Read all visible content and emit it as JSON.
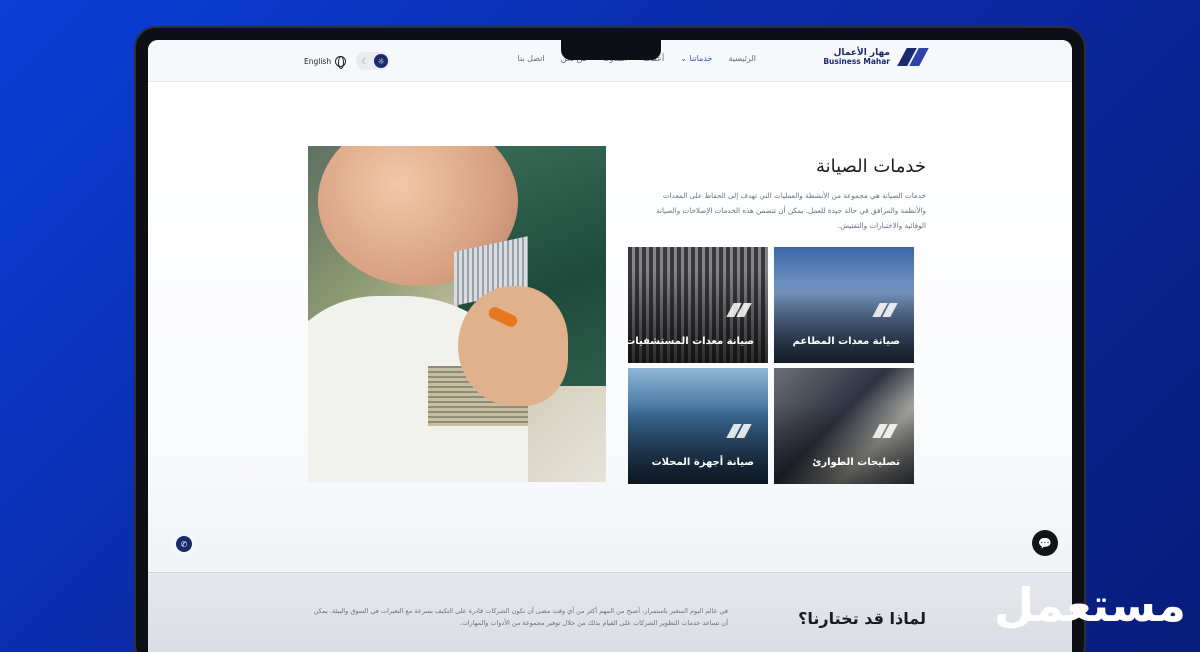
{
  "nav": {
    "lang_label": "English",
    "theme_light": "☼",
    "theme_dark": "☾",
    "items": [
      {
        "label": "الرئيسية"
      },
      {
        "label": "خدماتنا",
        "dropdown": true,
        "active": true
      },
      {
        "label": "أعمالنا"
      },
      {
        "label": "المدونة"
      },
      {
        "label": "من نحن"
      },
      {
        "label": "اتصل بنا"
      }
    ],
    "logo_ar": "مهار الأعمال",
    "logo_en": "Business Mahar"
  },
  "section": {
    "title": "خدمات الصيانة",
    "description": "خدمات الصيانة هي مجموعة من الأنشطة والعمليات التي تهدف إلى الحفاظ على المعدات والأنظمة والمرافق في حالة جيدة للعمل. يمكن أن تتضمن هذه الخدمات الإصلاحات والصيانة الوقائية والاختبارات والتفتيش."
  },
  "cards": [
    {
      "label": "صيانة معدات المطاعم"
    },
    {
      "label": "صيانة معدات المستشفيات"
    },
    {
      "label": "تصليحات الطوارئ"
    },
    {
      "label": "صيانة أجهزة المحلات"
    }
  ],
  "why": {
    "title": "لماذا قد تختارنا؟",
    "text": "في عالم اليوم المتغير باستمرار، أصبح من المهم أكثر من أي وقت مضى أن تكون الشركات قادرة على التكيف بسرعة مع التغيرات في السوق والبيئة. يمكن أن تساعد خدمات التطوير الشركات على القيام بذلك من خلال توفير مجموعة من الأدوات والمهارات."
  },
  "icons": {
    "chat": "chat-icon",
    "whatsapp": "whatsapp-icon",
    "globe": "globe-icon",
    "chevron": "chevron-down-icon"
  },
  "watermark": "مستعمل",
  "colors": {
    "brand": "#1a2b6d",
    "accent": "#3a55c9",
    "background": "#0a2aa6"
  }
}
